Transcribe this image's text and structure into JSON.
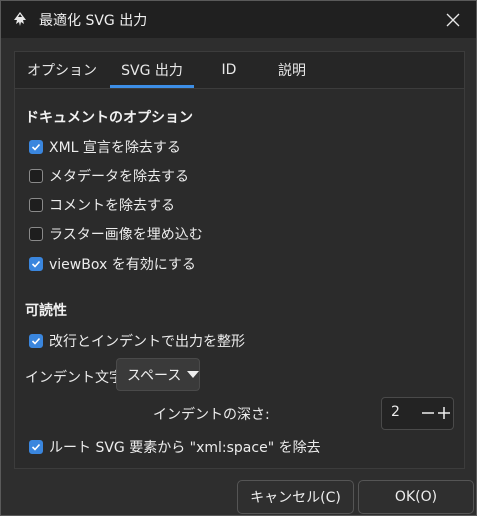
{
  "window": {
    "title": "最適化 SVG 出力"
  },
  "tabs": [
    {
      "label": "オプション",
      "active": false
    },
    {
      "label": "SVG 出力",
      "active": true
    },
    {
      "label": "ID",
      "active": false
    },
    {
      "label": "説明",
      "active": false
    }
  ],
  "document_options": {
    "heading": "ドキュメントのオプション",
    "items": [
      {
        "label": "XML 宣言を除去する",
        "checked": true
      },
      {
        "label": "メタデータを除去する",
        "checked": false
      },
      {
        "label": "コメントを除去する",
        "checked": false
      },
      {
        "label": "ラスター画像を埋め込む",
        "checked": false
      },
      {
        "label": "viewBox を有効にする",
        "checked": true
      }
    ]
  },
  "readability": {
    "heading": "可読性",
    "pretty_print": {
      "label": "改行とインデントで出力を整形",
      "checked": true
    },
    "indent_char_label": "インデント文字:",
    "indent_char_value": "スペース",
    "indent_depth_label": "インデントの深さ:",
    "indent_depth_value": "2",
    "remove_xml_space": {
      "label": "ルート SVG 要素から \"xml:space\" を除去",
      "checked": true
    }
  },
  "buttons": {
    "cancel": "キャンセル(C)",
    "ok": "OK(O)"
  },
  "colors": {
    "accent": "#3a86de",
    "background": "#2e2e2e",
    "titlebar": "#202020"
  }
}
